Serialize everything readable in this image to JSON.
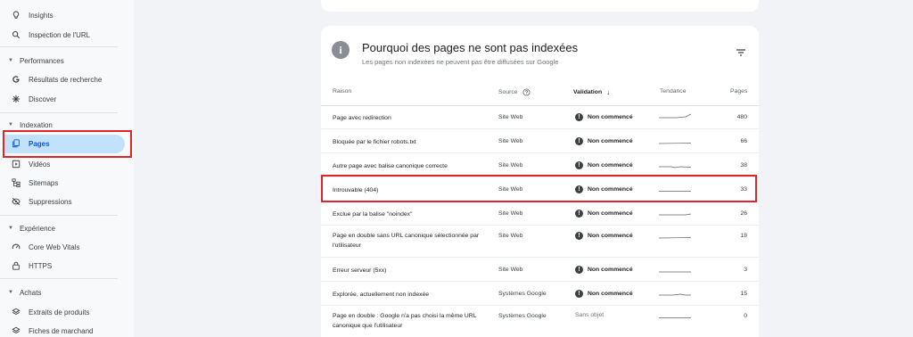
{
  "sidebar": {
    "items": [
      {
        "label": "Insights",
        "icon": "lightbulb-icon"
      },
      {
        "label": "Inspection de l'URL",
        "icon": "search-icon"
      }
    ],
    "sections": [
      {
        "label": "Performances",
        "items": [
          {
            "label": "Résultats de recherche",
            "icon": "google-g-icon"
          },
          {
            "label": "Discover",
            "icon": "asterisk-icon"
          }
        ]
      },
      {
        "label": "Indexation",
        "items": [
          {
            "label": "Pages",
            "icon": "pages-icon",
            "active": true
          },
          {
            "label": "Vidéos",
            "icon": "video-icon"
          },
          {
            "label": "Sitemaps",
            "icon": "sitemap-icon"
          },
          {
            "label": "Suppressions",
            "icon": "eye-off-icon"
          }
        ]
      },
      {
        "label": "Expérience",
        "items": [
          {
            "label": "Core Web Vitals",
            "icon": "gauge-icon"
          },
          {
            "label": "HTTPS",
            "icon": "lock-icon"
          }
        ]
      },
      {
        "label": "Achats",
        "items": [
          {
            "label": "Extraits de produits",
            "icon": "layers-icon"
          },
          {
            "label": "Fiches de marchand",
            "icon": "layers-icon"
          }
        ]
      }
    ]
  },
  "card": {
    "title": "Pourquoi des pages ne sont pas indexées",
    "subtitle": "Les pages non indexées ne peuvent pas être diffusées sur Google",
    "columns": {
      "reason": "Raison",
      "source": "Source",
      "validation": "Validation",
      "trend": "Tendance",
      "pages": "Pages"
    },
    "rows": [
      {
        "reason": "Page avec redirection",
        "source": "Site Web",
        "validation": "Non commencé",
        "status": "warn",
        "pages": "480"
      },
      {
        "reason": "Bloquée par le fichier robots.txt",
        "source": "Site Web",
        "validation": "Non commencé",
        "status": "warn",
        "pages": "66"
      },
      {
        "reason": "Autre page avec balise canonique correcte",
        "source": "Site Web",
        "validation": "Non commencé",
        "status": "warn",
        "pages": "38"
      },
      {
        "reason": "Introuvable (404)",
        "source": "Site Web",
        "validation": "Non commencé",
        "status": "warn",
        "pages": "33",
        "highlighted": true
      },
      {
        "reason": "Exclue par la balise \"noindex\"",
        "source": "Site Web",
        "validation": "Non commencé",
        "status": "warn",
        "pages": "26"
      },
      {
        "reason": "Page en double sans URL canonique sélectionnée par l'utilisateur",
        "source": "Site Web",
        "validation": "Non commencé",
        "status": "warn",
        "pages": "18"
      },
      {
        "reason": "Erreur serveur (5xx)",
        "source": "Site Web",
        "validation": "Non commencé",
        "status": "warn",
        "pages": "3"
      },
      {
        "reason": "Explorée, actuellement non indexée",
        "source": "Systèmes Google",
        "validation": "Non commencé",
        "status": "warn",
        "pages": "15"
      },
      {
        "reason": "Page en double : Google n'a pas choisi la même URL canonique que l'utilisateur",
        "source": "Systèmes Google",
        "validation": "Sans objet",
        "status": "none",
        "pages": "0"
      }
    ]
  },
  "colors": {
    "active_bg": "#c2e2fb",
    "active_text": "#0b57d0",
    "highlight_border": "#e0242b"
  }
}
